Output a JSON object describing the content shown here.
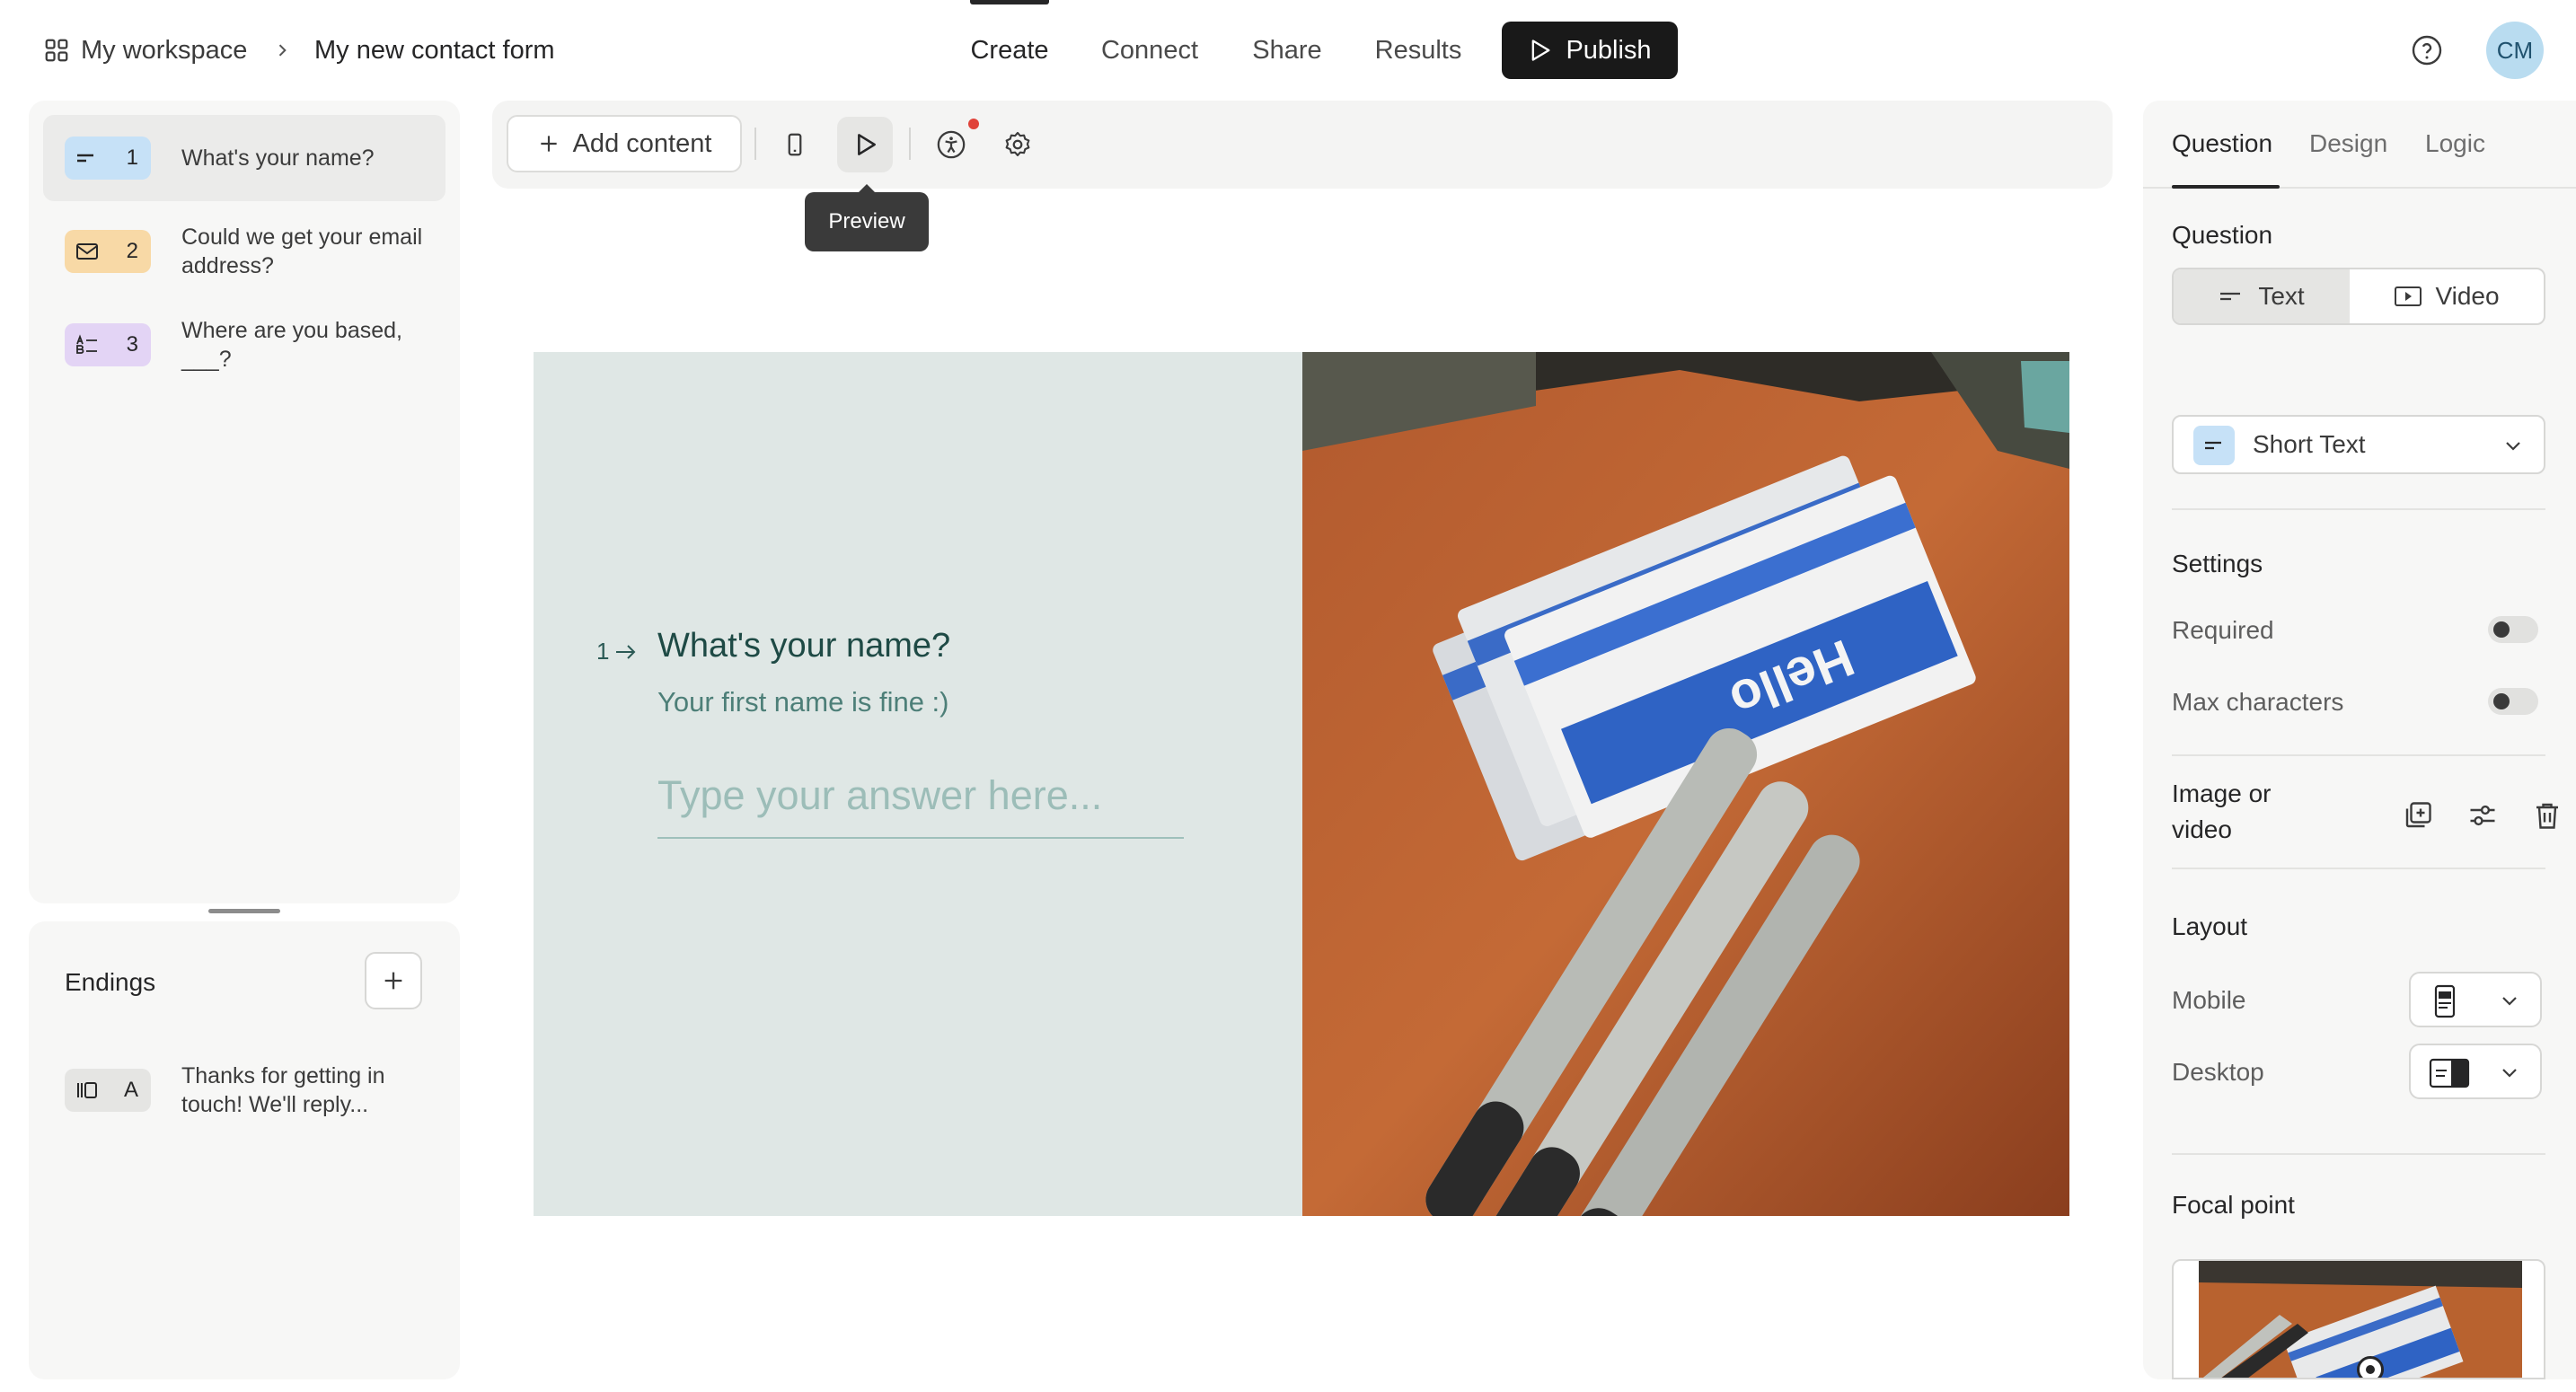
{
  "header": {
    "workspace_label": "My workspace",
    "form_title": "My new contact form",
    "nav": [
      "Create",
      "Connect",
      "Share",
      "Results"
    ],
    "publish_label": "Publish",
    "avatar_initials": "CM"
  },
  "questions": [
    {
      "number": "1",
      "text": "What's your name?",
      "type_icon": "short-text-icon",
      "color": "#c6e1f7"
    },
    {
      "number": "2",
      "text": "Could we get your email address?",
      "type_icon": "envelope-icon",
      "color": "#f8d9a6"
    },
    {
      "number": "3",
      "text": "Where are you based, ___?",
      "type_icon": "multiple-choice-icon",
      "color": "#e3d4f5"
    }
  ],
  "endings": {
    "title": "Endings",
    "items": [
      {
        "letter": "A",
        "text": "Thanks for getting in touch! We'll reply...",
        "color": "#e5e5e3"
      }
    ]
  },
  "toolbar": {
    "add_content_label": "Add content",
    "tooltip": "Preview"
  },
  "preview": {
    "number": "1",
    "title": "What's your name?",
    "description": "Your first name is fine :)",
    "answer_placeholder": "Type your answer here...",
    "background_color": "#dfe7e5",
    "image_text": "Hello"
  },
  "settings_panel": {
    "tabs": [
      "Question",
      "Design",
      "Logic"
    ],
    "question_section": "Question",
    "text_option": "Text",
    "video_option": "Video",
    "question_type": "Short Text",
    "settings_section": "Settings",
    "required_label": "Required",
    "required_on": false,
    "max_chars_label": "Max characters",
    "max_chars_on": false,
    "image_video_label": "Image or video",
    "layout_section": "Layout",
    "mobile_label": "Mobile",
    "desktop_label": "Desktop",
    "focal_point_label": "Focal point"
  }
}
